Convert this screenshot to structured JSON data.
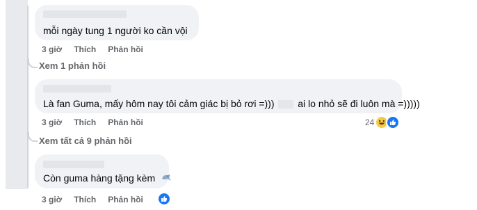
{
  "comments": [
    {
      "text": "mỗi ngày tung 1 người ko cần vội",
      "time": "3 giờ",
      "like": "Thích",
      "reply": "Phản hồi"
    },
    {
      "text_before": "Là fan Guma, mấy hôm nay tôi cảm giác bị bỏ rơi =)))",
      "text_after": "ai lo nhỏ sẽ đi luôn mà =)))))",
      "time": "3 giờ",
      "like": "Thích",
      "reply": "Phản hồi",
      "reaction_count": "24",
      "reactions": [
        "haha-icon",
        "like-icon"
      ]
    },
    {
      "text": "Còn guma hàng tặng kèm",
      "time": "3 giờ",
      "like": "Thích",
      "reply": "Phản hồi",
      "reactions": [
        "like-icon"
      ]
    }
  ],
  "view_replies": [
    "Xem 1 phản hồi",
    "Xem tất cả 9 phản hồi"
  ],
  "colors": {
    "bubble": "#f0f2f5",
    "muted_text": "#65676b",
    "like_blue": "#1877f2",
    "haha_yellow": "#f7c948"
  }
}
